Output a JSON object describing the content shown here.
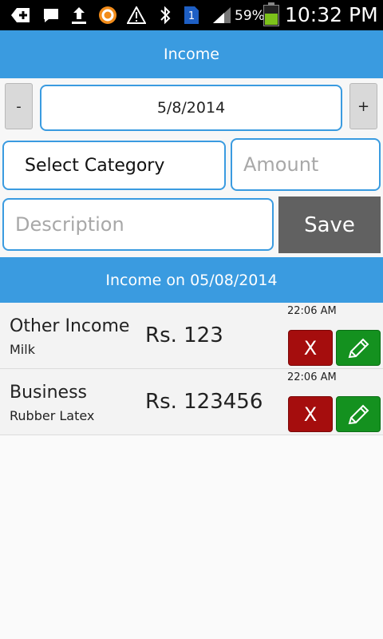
{
  "status_bar": {
    "battery_percent": "59%",
    "time": "10:32 PM",
    "icons": [
      "add-box-icon",
      "message-icon",
      "upload-icon",
      "orange-app-icon",
      "warning-icon",
      "bluetooth-icon",
      "sim-one-icon",
      "signal-icon",
      "battery-icon"
    ],
    "sim_badge": "1"
  },
  "header": {
    "title": "Income"
  },
  "form": {
    "decrement_label": "-",
    "increment_label": "+",
    "date_value": "5/8/2014",
    "category_value": "Select Category",
    "amount_placeholder": "Amount",
    "description_placeholder": "Description",
    "save_label": "Save"
  },
  "list_header": {
    "title": "Income on 05/08/2014"
  },
  "entries": [
    {
      "category": "Other Income",
      "description": "Milk",
      "amount": "Rs. 123",
      "time": "22:06 AM",
      "delete_label": "X"
    },
    {
      "category": "Business",
      "description": "Rubber Latex",
      "amount": "Rs. 123456",
      "time": "22:06 AM",
      "delete_label": "X"
    }
  ],
  "colors": {
    "accent": "#3a9be0",
    "delete": "#a50d0d",
    "edit": "#14911f",
    "save": "#616161"
  }
}
